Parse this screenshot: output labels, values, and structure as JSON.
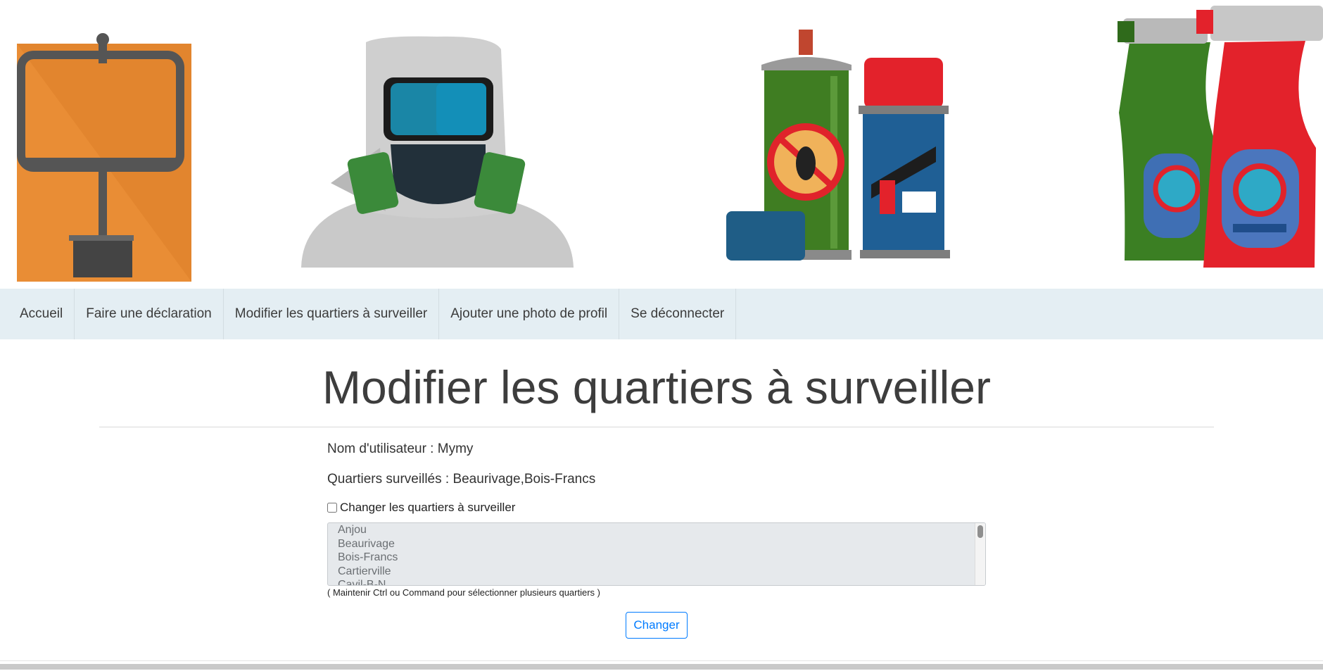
{
  "banner": {
    "images": [
      "mouse-trap",
      "hazmat-suit",
      "spray-cans",
      "spray-bottles"
    ]
  },
  "nav": {
    "items": [
      {
        "label": "Accueil"
      },
      {
        "label": "Faire une déclaration"
      },
      {
        "label": "Modifier les quartiers à surveiller"
      },
      {
        "label": "Ajouter une photo de profil"
      },
      {
        "label": "Se déconnecter"
      }
    ]
  },
  "page": {
    "title": "Modifier les quartiers à surveiller",
    "username_line": "Nom d'utilisateur : Mymy",
    "quartiers_line": "Quartiers surveillés : Beaurivage,Bois-Francs",
    "checkbox_label": "Changer les quartiers à surveiller",
    "checkbox_checked": false,
    "options": [
      "Anjou",
      "Beaurivage",
      "Bois-Francs",
      "Cartierville",
      "Cavil-B-N"
    ],
    "hint": "( Maintenir Ctrl ou Command pour sélectionner plusieurs quartiers )",
    "submit_label": "Changer"
  },
  "colors": {
    "nav_bg": "#e4eef3",
    "button_accent": "#007bff"
  }
}
